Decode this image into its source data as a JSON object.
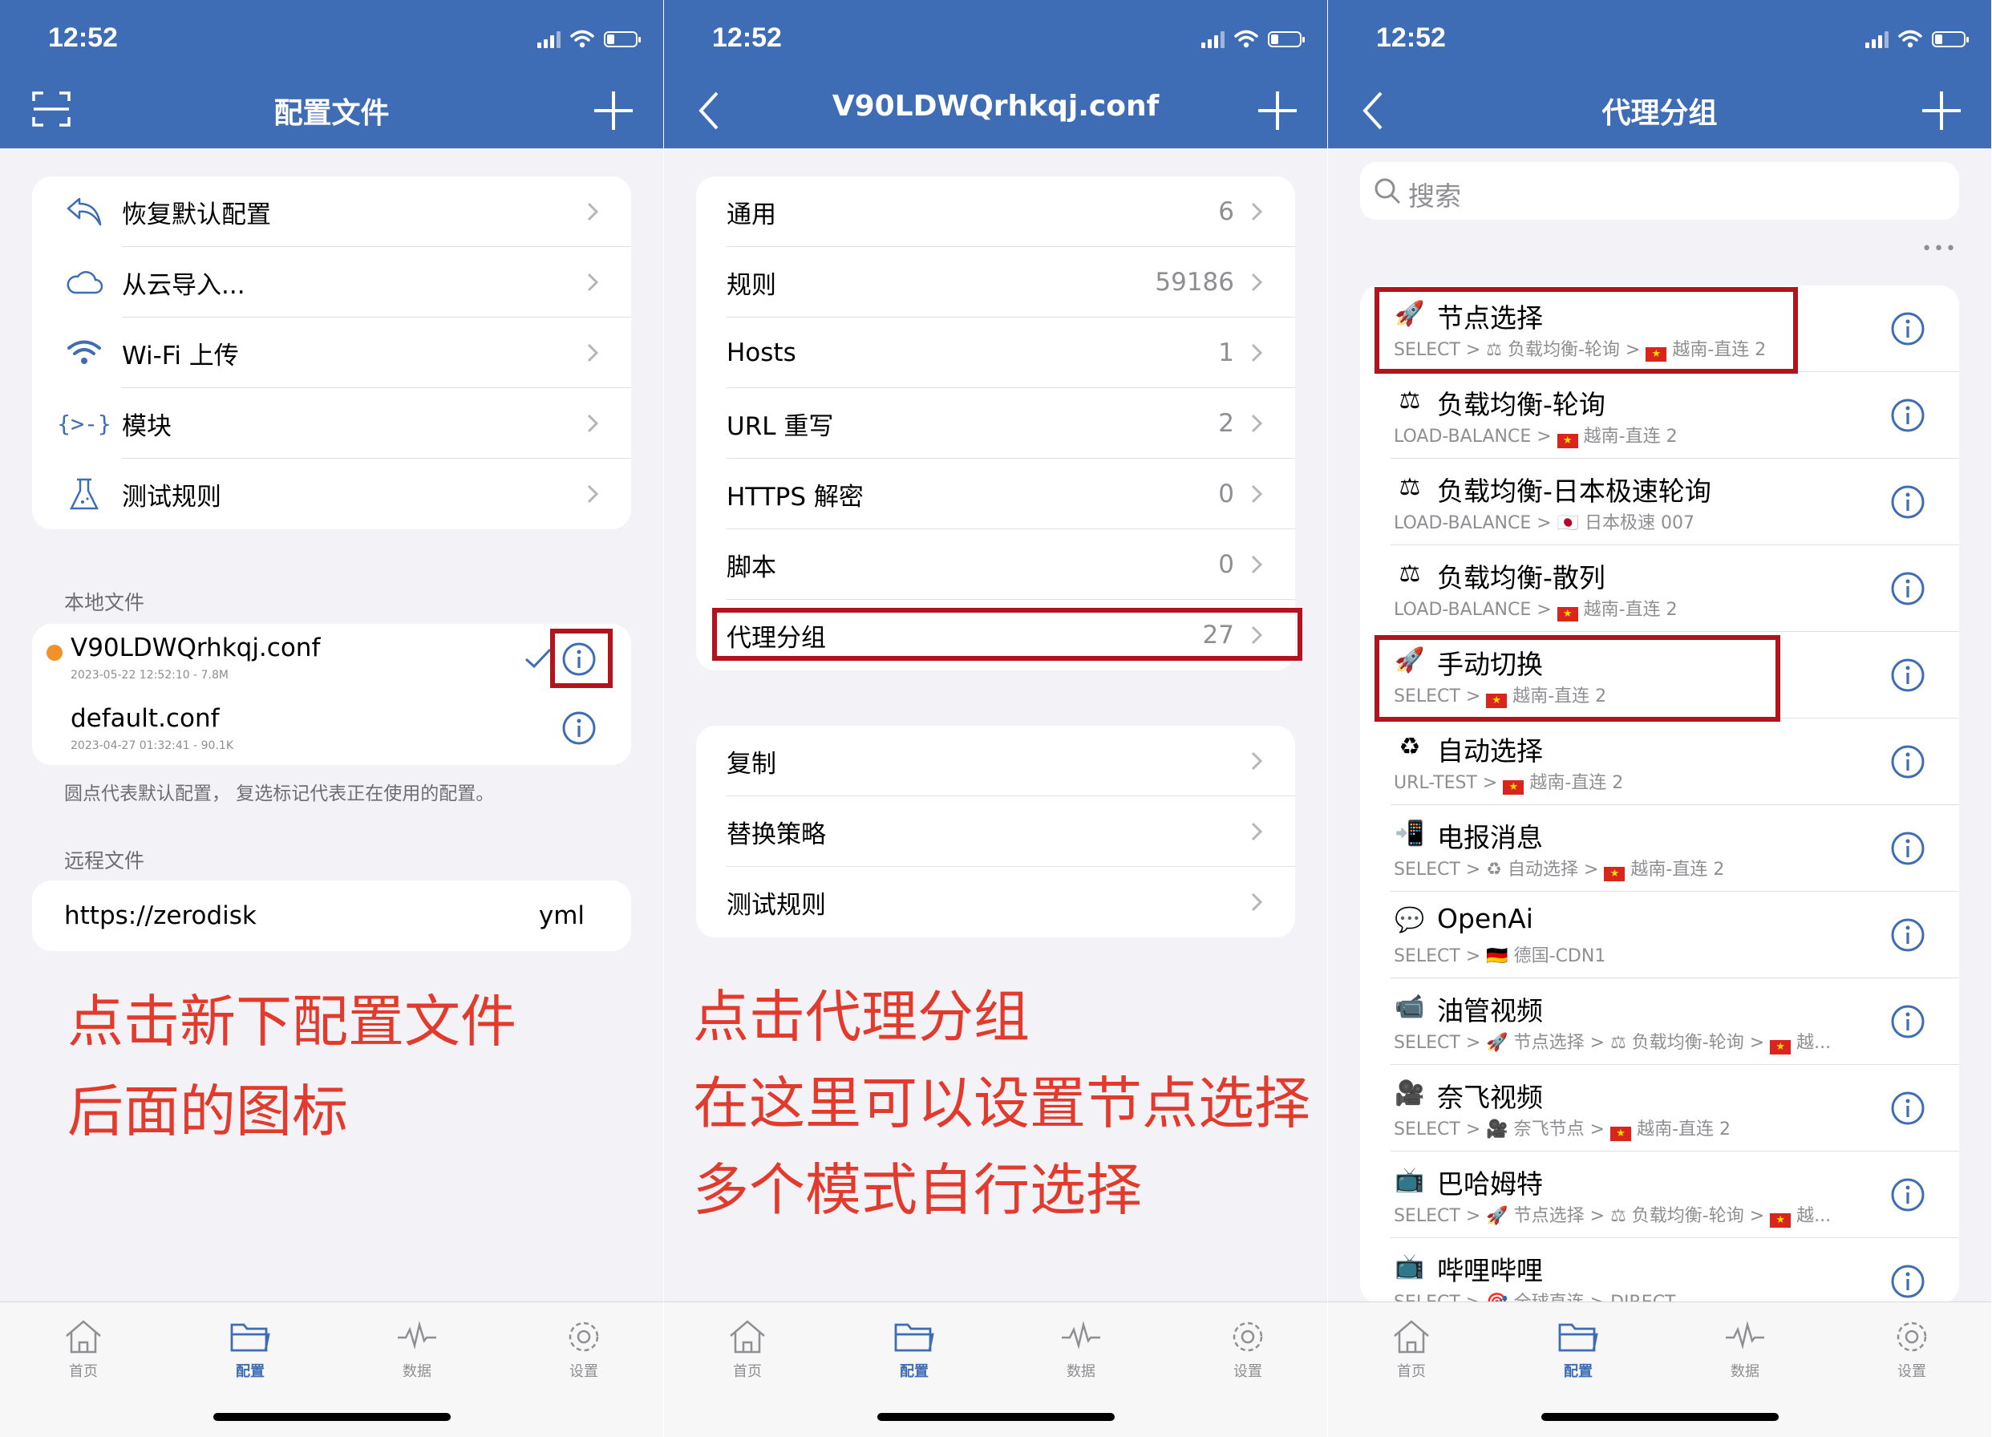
{
  "status_time": "12:52",
  "panel1": {
    "title": "配置文件",
    "menu": [
      {
        "icon": "undo-arrow-icon",
        "label": "恢复默认配置"
      },
      {
        "icon": "cloud-icon",
        "label": "从云导入..."
      },
      {
        "icon": "wifi-icon",
        "label": "Wi-Fi 上传"
      },
      {
        "icon": "module-braces-icon",
        "label": "模块"
      },
      {
        "icon": "flask-icon",
        "label": "测试规则"
      }
    ],
    "local_header": "本地文件",
    "local_files": [
      {
        "name": "V90LDWQrhkqj.conf",
        "meta": "2023-05-22 12:52:10 - 7.8M",
        "default": true,
        "in_use": true
      },
      {
        "name": "default.conf",
        "meta": "2023-04-27 01:32:41 - 90.1K",
        "default": false,
        "in_use": false
      }
    ],
    "local_note": "圆点代表默认配置， 复选标记代表正在使用的配置。",
    "remote_header": "远程文件",
    "remote_files": [
      {
        "url": "https://zerodisk",
        "ext": "yml"
      }
    ],
    "instruction_lines": [
      "点击新下配置文件",
      "后面的图标"
    ]
  },
  "panel2": {
    "title": "V90LDWQrhkqj.conf",
    "sections": [
      {
        "label": "通用",
        "count": "6"
      },
      {
        "label": "规则",
        "count": "59186"
      },
      {
        "label": "Hosts",
        "count": "1"
      },
      {
        "label": "URL 重写",
        "count": "2"
      },
      {
        "label": "HTTPS 解密",
        "count": "0"
      },
      {
        "label": "脚本",
        "count": "0"
      },
      {
        "label": "代理分组",
        "count": "27"
      }
    ],
    "actions": [
      {
        "label": "复制"
      },
      {
        "label": "替换策略"
      },
      {
        "label": "测试规则"
      }
    ],
    "instruction_lines": [
      "点击代理分组",
      "在这里可以设置节点选择",
      "多个模式自行选择"
    ]
  },
  "panel3": {
    "title": "代理分组",
    "search_placeholder": "搜索",
    "more_label": "•••",
    "groups": [
      {
        "emoji": "🚀",
        "name": "节点选择",
        "path": [
          "SELECT >",
          "⚖ 负载均衡-轮询 >",
          "FLAG越南-直连 2"
        ]
      },
      {
        "emoji": "⚖",
        "name": "负载均衡-轮询",
        "path": [
          "LOAD-BALANCE >",
          "FLAG越南-直连 2"
        ]
      },
      {
        "emoji": "⚖",
        "name": "负载均衡-日本极速轮询",
        "path": [
          "LOAD-BALANCE >",
          "🇯🇵 日本极速 007"
        ]
      },
      {
        "emoji": "⚖",
        "name": "负载均衡-散列",
        "path": [
          "LOAD-BALANCE >",
          "FLAG越南-直连 2"
        ]
      },
      {
        "emoji": "🚀",
        "name": "手动切换",
        "path": [
          "SELECT >",
          "FLAG越南-直连 2"
        ]
      },
      {
        "emoji": "♻",
        "name": "自动选择",
        "path": [
          "URL-TEST >",
          "FLAG越南-直连 2"
        ]
      },
      {
        "emoji": "📲",
        "name": "电报消息",
        "path": [
          "SELECT >",
          "♻ 自动选择 >",
          "FLAG越南-直连 2"
        ]
      },
      {
        "emoji": "💬",
        "name": "OpenAi",
        "path": [
          "SELECT >",
          "🇩🇪 德国-CDN1"
        ]
      },
      {
        "emoji": "📹",
        "name": "油管视频",
        "path": [
          "SELECT >",
          "🚀 节点选择 >",
          "⚖ 负载均衡-轮询 >",
          "FLAG越..."
        ]
      },
      {
        "emoji": "🎥",
        "name": "奈飞视频",
        "path": [
          "SELECT >",
          "🎥 奈飞节点 >",
          "FLAG越南-直连 2"
        ]
      },
      {
        "emoji": "📺",
        "name": "巴哈姆特",
        "path": [
          "SELECT >",
          "🚀 节点选择 >",
          "⚖ 负载均衡-轮询 >",
          "FLAG越..."
        ]
      },
      {
        "emoji": "📺",
        "name": "哔哩哔哩",
        "path": [
          "SELECT >",
          "🎯 全球直连 >",
          "DIRECT"
        ]
      }
    ]
  },
  "tabbar": [
    {
      "icon": "home-icon",
      "label": "首页"
    },
    {
      "icon": "folder-icon",
      "label": "配置"
    },
    {
      "icon": "pulse-icon",
      "label": "数据"
    },
    {
      "icon": "gear-icon",
      "label": "设置"
    }
  ],
  "active_tab": "配置",
  "colors": {
    "nav": "#3e6cb5",
    "highlight_box": "#b2141d",
    "instruction_text": "#e23a2c",
    "default_dot": "#f0912b"
  }
}
